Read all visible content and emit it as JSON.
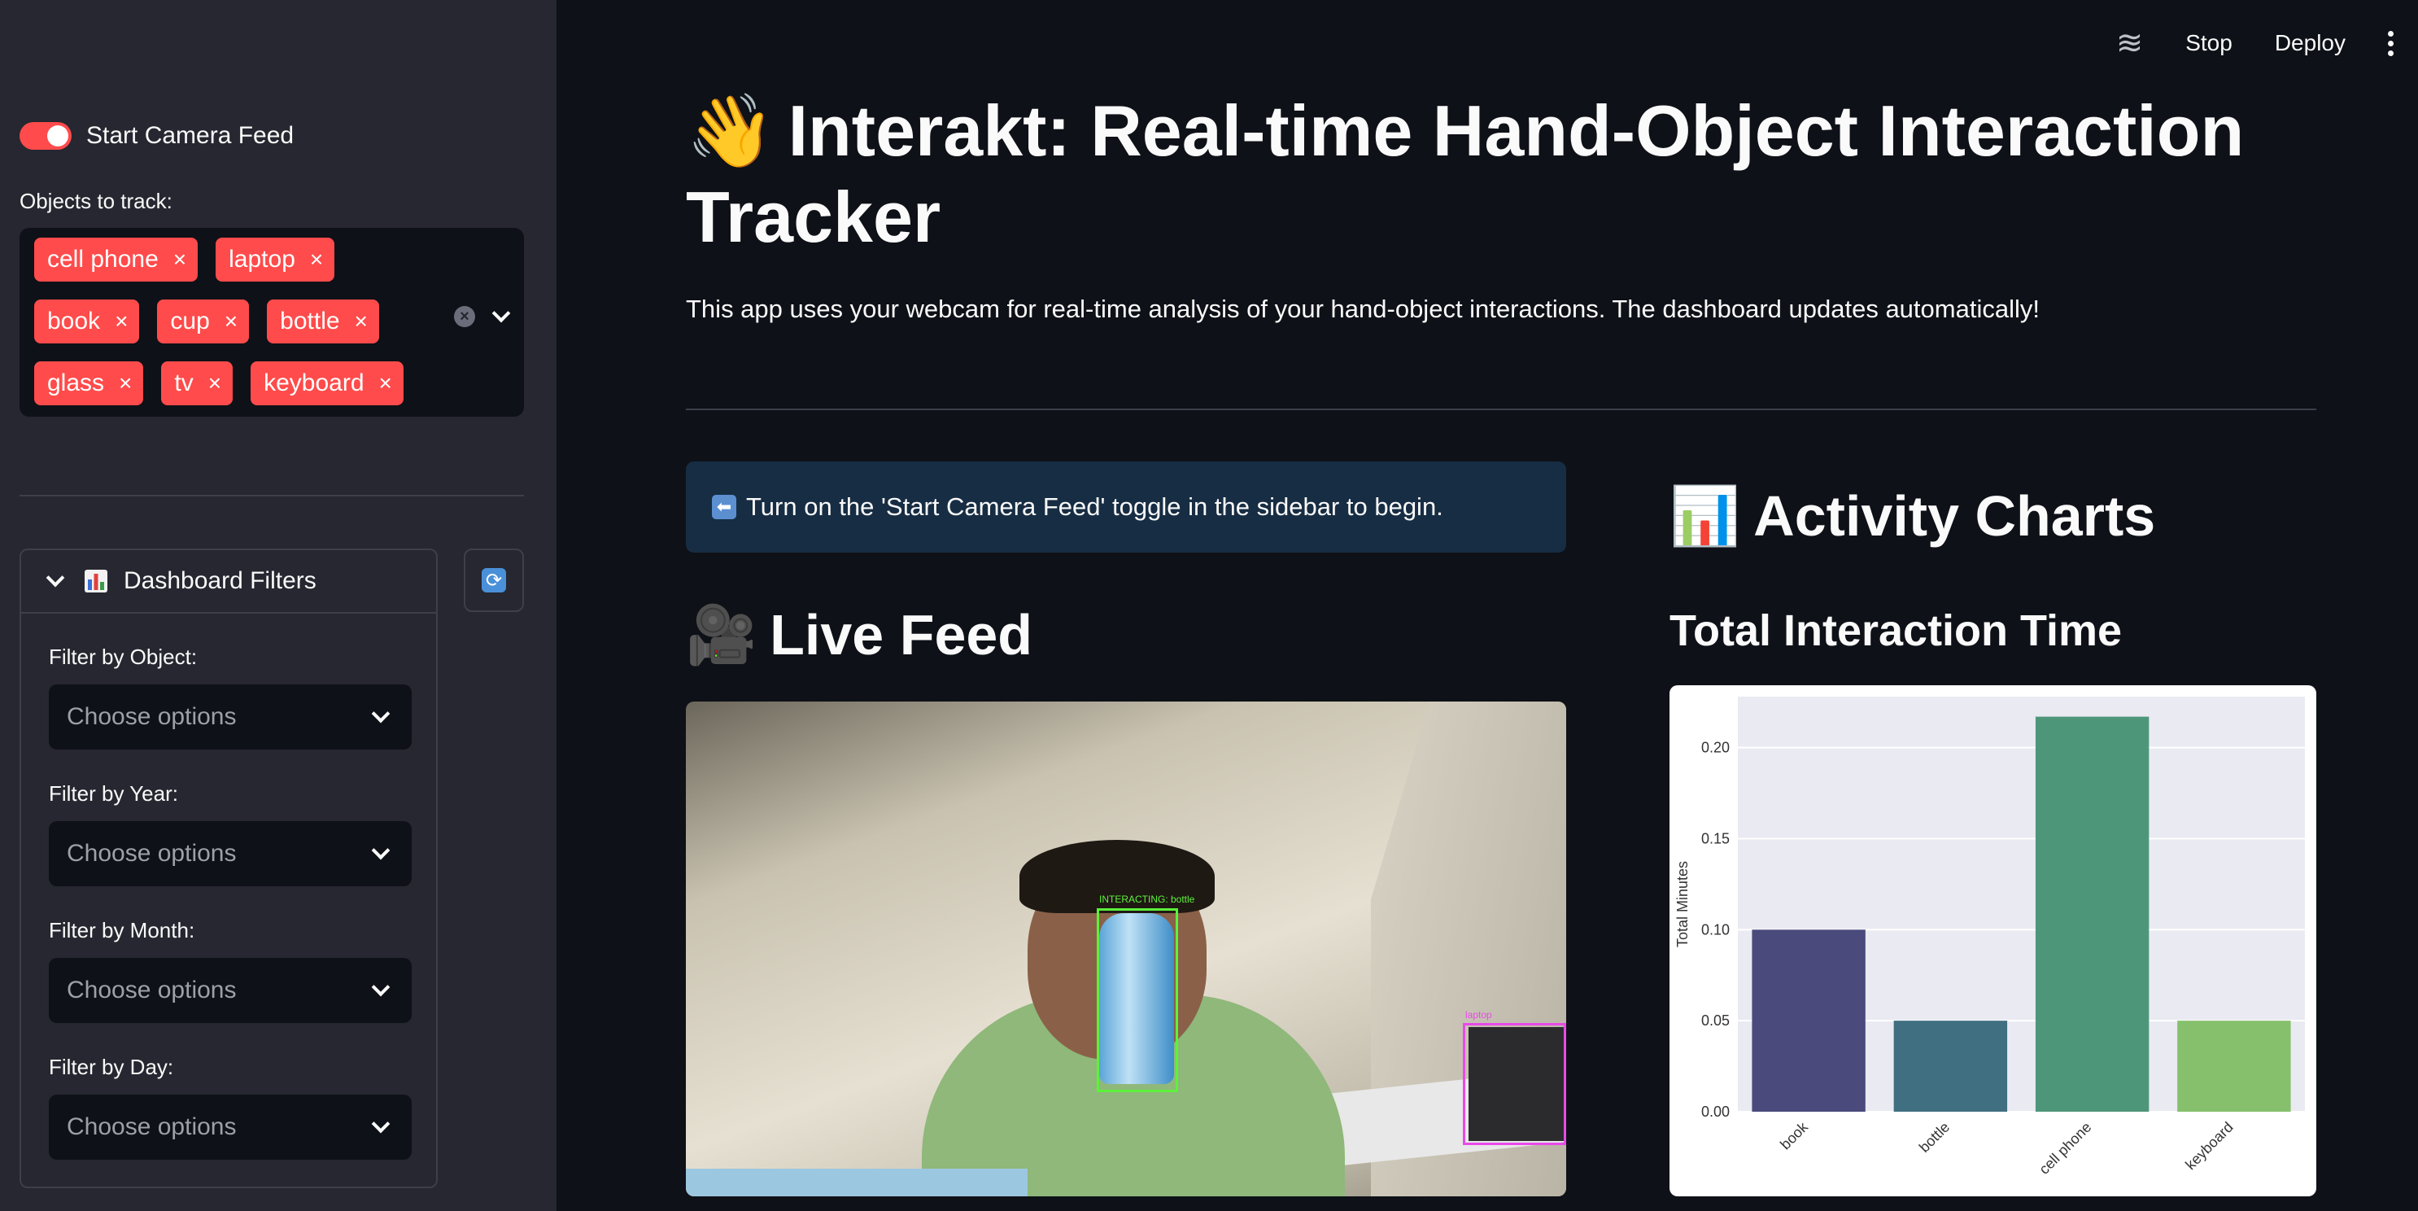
{
  "header": {
    "stop_label": "Stop",
    "deploy_label": "Deploy"
  },
  "sidebar": {
    "toggle_label": "Start Camera Feed",
    "objects_label": "Objects to track:",
    "tags_row1": [
      "cell phone",
      "laptop"
    ],
    "tags_row2": [
      "book",
      "cup",
      "bottle"
    ],
    "tags_row3": [
      "glass",
      "tv",
      "keyboard"
    ],
    "expander_title": "Dashboard Filters",
    "filters": [
      {
        "label": "Filter by Object:",
        "placeholder": "Choose options"
      },
      {
        "label": "Filter by Year:",
        "placeholder": "Choose options"
      },
      {
        "label": "Filter by Month:",
        "placeholder": "Choose options"
      },
      {
        "label": "Filter by Day:",
        "placeholder": "Choose options"
      }
    ]
  },
  "main": {
    "title": "Interakt: Real-time Hand-Object Interaction Tracker",
    "subtitle": "This app uses your webcam for real-time analysis of your hand-object interactions. The dashboard updates automatically!",
    "info_text": "Turn on the 'Start Camera Feed' toggle in the sidebar to begin.",
    "live_feed_title": "Live Feed",
    "activity_title": "Activity Charts",
    "chart_title": "Total Interaction Time",
    "feed_labels": {
      "bottle": "INTERACTING: bottle",
      "laptop": "laptop"
    }
  },
  "colors": {
    "accent": "#ff4b4b",
    "sidebar_bg": "#262730",
    "app_bg": "#0e1117",
    "info_bg": "#172d43"
  },
  "chart_data": {
    "type": "bar",
    "categories": [
      "book",
      "bottle",
      "cell phone",
      "keyboard"
    ],
    "values": [
      0.1,
      0.05,
      0.217,
      0.05
    ],
    "colors": [
      "#4a4a7c",
      "#3f6f80",
      "#4e967a",
      "#86c06c"
    ],
    "ylabel": "Total Minutes",
    "xlabel": "",
    "yticks": [
      "0.00",
      "0.05",
      "0.10",
      "0.15",
      "0.20"
    ],
    "ylim": [
      0,
      0.228
    ],
    "grid": true
  }
}
